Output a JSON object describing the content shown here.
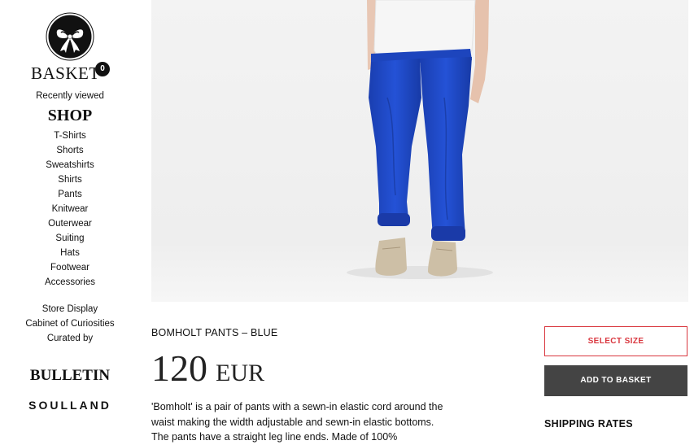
{
  "sidebar": {
    "logo_icon": "bow-tie-logo-icon",
    "basket_label": "BASKET",
    "basket_count": "0",
    "recently_viewed": "Recently viewed",
    "shop_heading": "SHOP",
    "categories": [
      "T-Shirts",
      "Shorts",
      "Sweatshirts",
      "Shirts",
      "Pants",
      "Knitwear",
      "Outerwear",
      "Suiting",
      "Hats",
      "Footwear",
      "Accessories"
    ],
    "extra_links": [
      "Store Display",
      "Cabinet of Curiosities",
      "Curated by"
    ],
    "bulletin": "BULLETIN",
    "brand": "SOULLAND"
  },
  "product": {
    "title": "BOMHOLT PANTS – BLUE",
    "price": "120",
    "currency": "EUR",
    "description": "'Bomholt' is a pair of pants with a sewn-in elastic cord around the waist making the width adjustable and sewn-in elastic bottoms. The pants have a straight leg line ends. Made of 100%",
    "pants_color": "#1f48c4"
  },
  "actions": {
    "select_size": "SELECT SIZE",
    "add_to_basket": "ADD TO BASKET",
    "shipping_rates": "SHIPPING RATES"
  },
  "colors": {
    "accent_red": "#d9363e",
    "button_dark": "#444444"
  }
}
